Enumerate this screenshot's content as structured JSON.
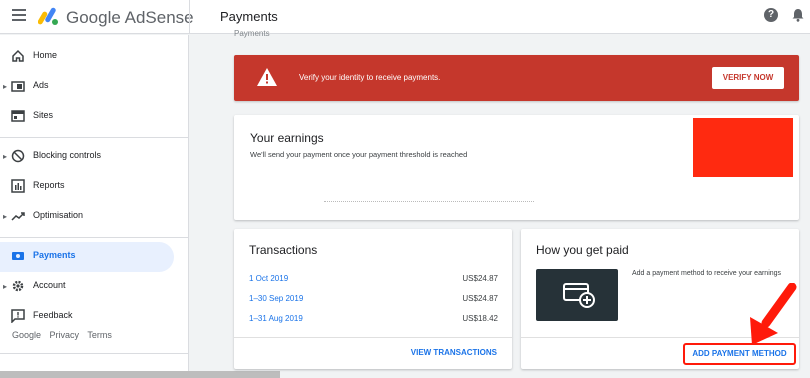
{
  "header": {
    "brand": "Google AdSense",
    "page_title": "Payments",
    "help_glyph": "?"
  },
  "sidebar": {
    "items": [
      {
        "label": "Home",
        "icon": "home-icon",
        "has_caret": false,
        "active": false
      },
      {
        "label": "Ads",
        "icon": "ads-icon",
        "has_caret": true,
        "active": false
      },
      {
        "label": "Sites",
        "icon": "sites-icon",
        "has_caret": false,
        "active": false
      },
      {
        "label": "Blocking controls",
        "icon": "block-icon",
        "has_caret": true,
        "active": false
      },
      {
        "label": "Reports",
        "icon": "reports-icon",
        "has_caret": false,
        "active": false
      },
      {
        "label": "Optimisation",
        "icon": "trend-icon",
        "has_caret": true,
        "active": false
      },
      {
        "label": "Payments",
        "icon": "payments-icon",
        "has_caret": false,
        "active": true
      },
      {
        "label": "Account",
        "icon": "gear-icon",
        "has_caret": true,
        "active": false
      },
      {
        "label": "Feedback",
        "icon": "feedback-icon",
        "has_caret": false,
        "active": false
      }
    ],
    "footer": {
      "google": "Google",
      "privacy": "Privacy",
      "terms": "Terms"
    }
  },
  "main": {
    "breadcrumb": "Payments",
    "alert": {
      "text": "Verify your identity to receive payments.",
      "button": "VERIFY NOW",
      "color": "#c5372c"
    },
    "earnings": {
      "title": "Your earnings",
      "subtitle": "We'll send your payment once your payment threshold is reached"
    },
    "transactions": {
      "title": "Transactions",
      "rows": [
        {
          "date": "1 Oct 2019",
          "amount": "US$24.87"
        },
        {
          "date": "1–30 Sep 2019",
          "amount": "US$24.87"
        },
        {
          "date": "1–31 Aug 2019",
          "amount": "US$18.42"
        }
      ],
      "action": "VIEW TRANSACTIONS"
    },
    "how_paid": {
      "title": "How you get paid",
      "description": "Add a payment method to receive your earnings",
      "action": "ADD PAYMENT METHOD"
    }
  },
  "colors": {
    "accent": "#1a73e8",
    "alert": "#c5372c",
    "highlight": "#ff1a0a"
  }
}
